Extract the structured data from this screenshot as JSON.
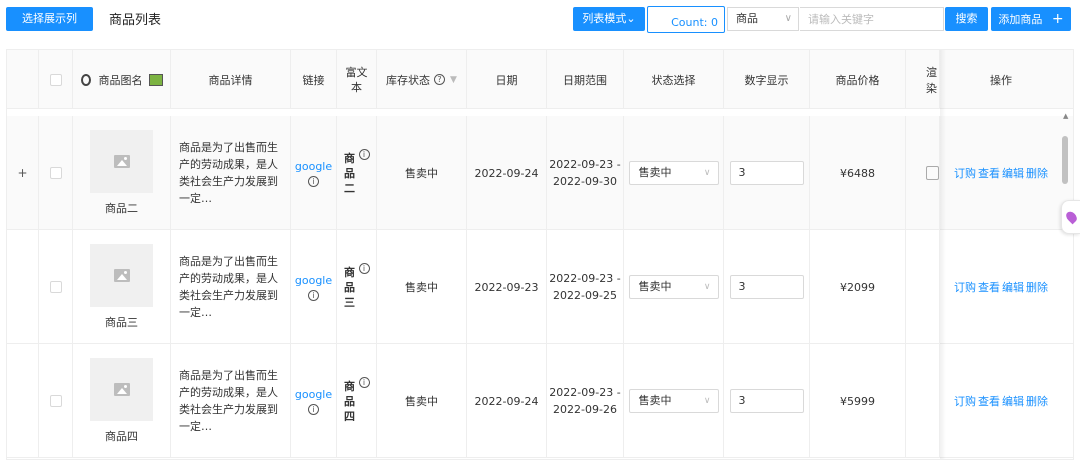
{
  "toolbar": {
    "choose_columns_label": "选择展示列",
    "title": "商品列表",
    "list_mode_label": "列表模式",
    "count_label": "Count: 0",
    "category_value": "商品",
    "keyword_placeholder": "请输入关键字",
    "search_label": "搜索",
    "add_label": "添加商品"
  },
  "table": {
    "headers": {
      "name": "商品图名",
      "detail": "商品详情",
      "link": "链接",
      "rich": "富文本",
      "stock": "库存状态",
      "date": "日期",
      "range": "日期范围",
      "status_select": "状态选择",
      "number": "数字显示",
      "price": "商品价格",
      "render": "渲染",
      "actions": "操作"
    },
    "rows": [
      {
        "name": "商品二",
        "detail": "商品是为了出售而生产的劳动成果，是人类社会生产力发展到一定…",
        "link": "google",
        "rich": "商品二",
        "stock": "售卖中",
        "date": "2022-09-24",
        "range_start": "2022-09-23 -",
        "range_end": "2022-09-30",
        "status": "售卖中",
        "number": "3",
        "price": "¥6488",
        "expanded_symbol": "+"
      },
      {
        "name": "商品三",
        "detail": "商品是为了出售而生产的劳动成果，是人类社会生产力发展到一定…",
        "link": "google",
        "rich": "商品三",
        "stock": "售卖中",
        "date": "2022-09-23",
        "range_start": "2022-09-23 -",
        "range_end": "2022-09-25",
        "status": "售卖中",
        "number": "3",
        "price": "¥2099"
      },
      {
        "name": "商品四",
        "detail": "商品是为了出售而生产的劳动成果，是人类社会生产力发展到一定…",
        "link": "google",
        "rich": "商品四",
        "stock": "售卖中",
        "date": "2022-09-24",
        "range_start": "2022-09-23 -",
        "range_end": "2022-09-26",
        "status": "售卖中",
        "number": "3",
        "price": "¥5999"
      }
    ],
    "actions": {
      "order": "订购",
      "view": "查看",
      "edit": "编辑",
      "delete": "删除"
    }
  },
  "colors": {
    "accent": "#1890ff"
  }
}
